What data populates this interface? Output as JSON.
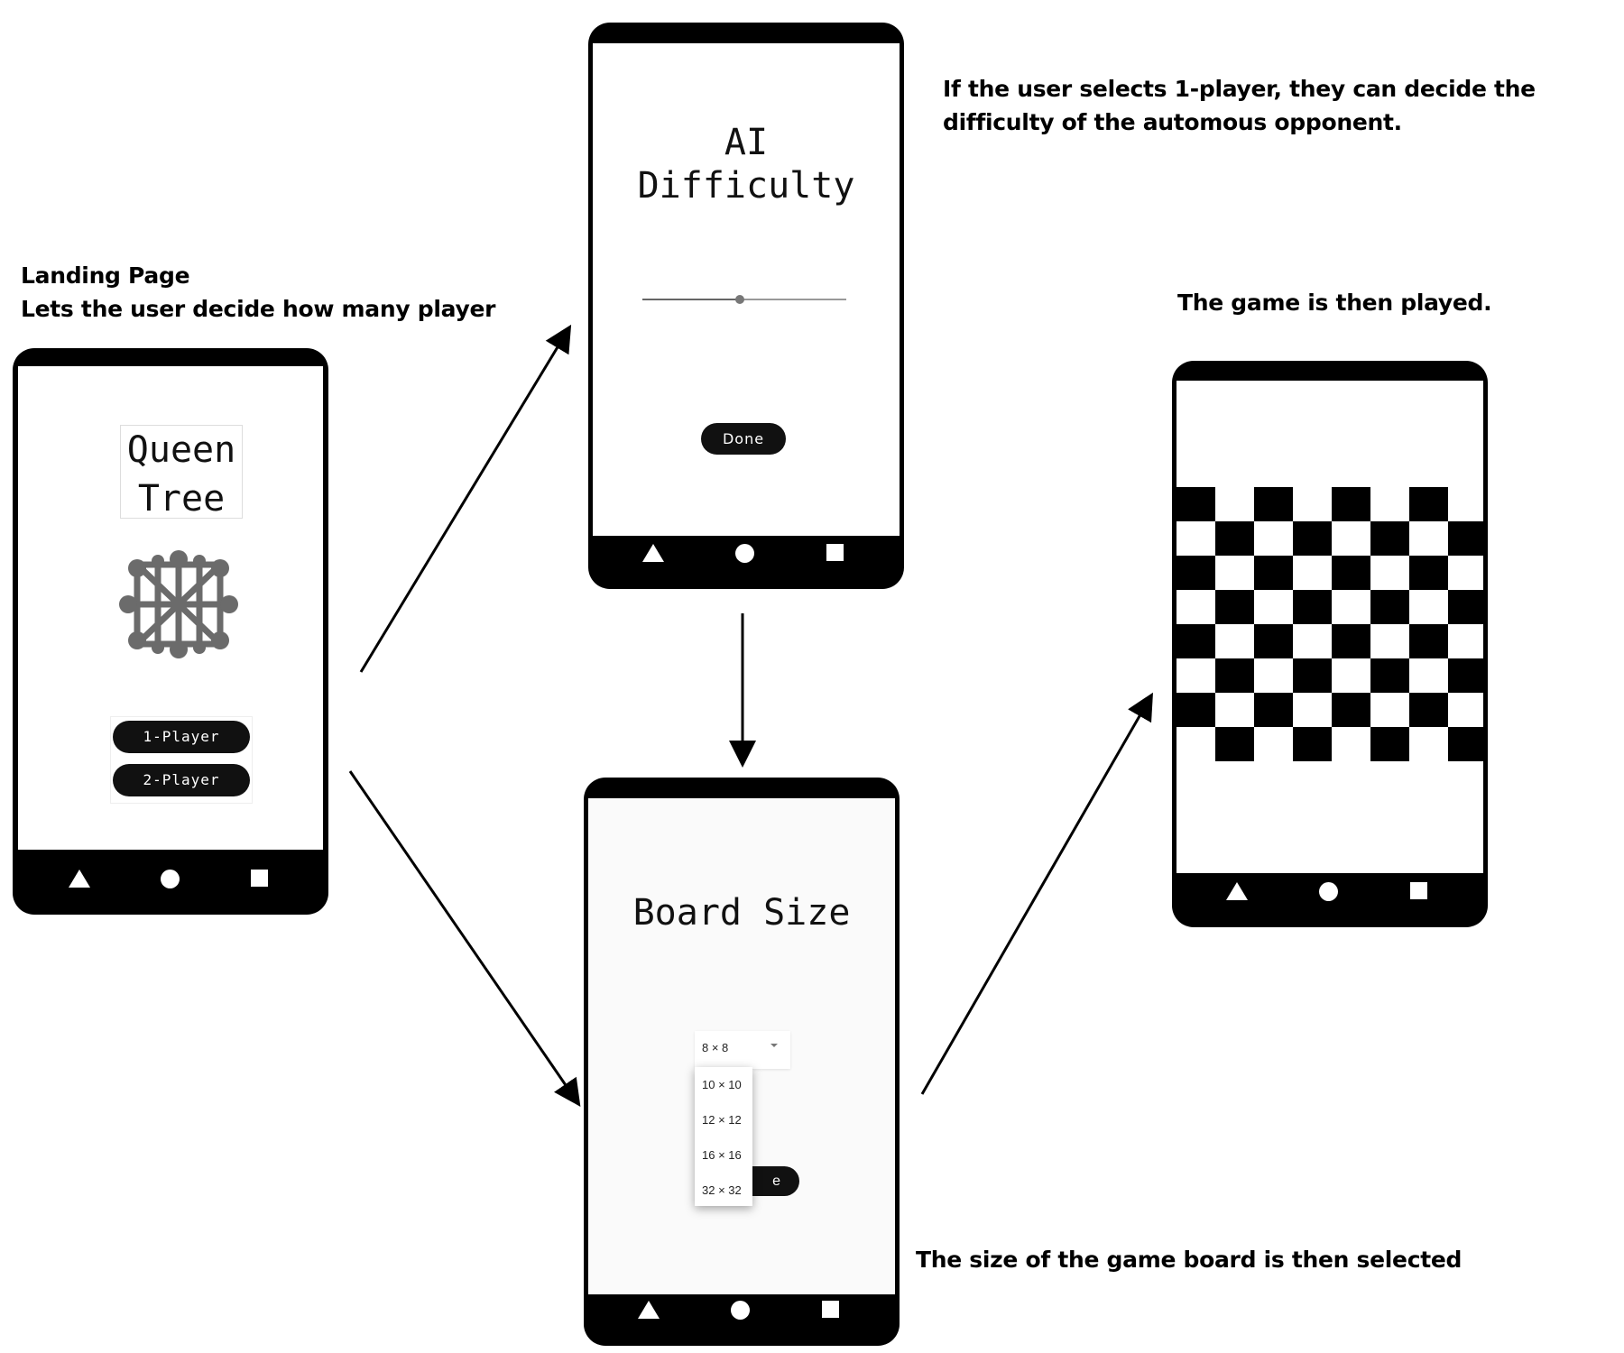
{
  "notes": {
    "landing_line1": "Landing Page",
    "landing_line2": "Lets the user decide how many player",
    "difficulty_line1": "If the user selects 1-player, they can decide the",
    "difficulty_line2": "difficulty of the automous opponent.",
    "board_size": "The size of the game board is then  selected",
    "game": "The game is then played."
  },
  "landing": {
    "title_line1": "Queen",
    "title_line2": "Tree",
    "logo_icon": "queen-tree-logo-icon",
    "one_player": "1-Player",
    "two_player": "2-Player"
  },
  "difficulty": {
    "title_line1": "AI",
    "title_line2": "Difficulty",
    "slider_value": 0.48,
    "done": "Done"
  },
  "board_size": {
    "title": "Board Size",
    "selected": "8 × 8",
    "options": [
      "10 × 10",
      "12 × 12",
      "16 × 16",
      "32 × 32"
    ],
    "hidden_button_fragment": "e"
  },
  "nav_icons": [
    "back-triangle-icon",
    "home-circle-icon",
    "recents-square-icon"
  ],
  "colors": {
    "frame": "#000000",
    "screen": "#ffffff",
    "button": "#111111"
  }
}
